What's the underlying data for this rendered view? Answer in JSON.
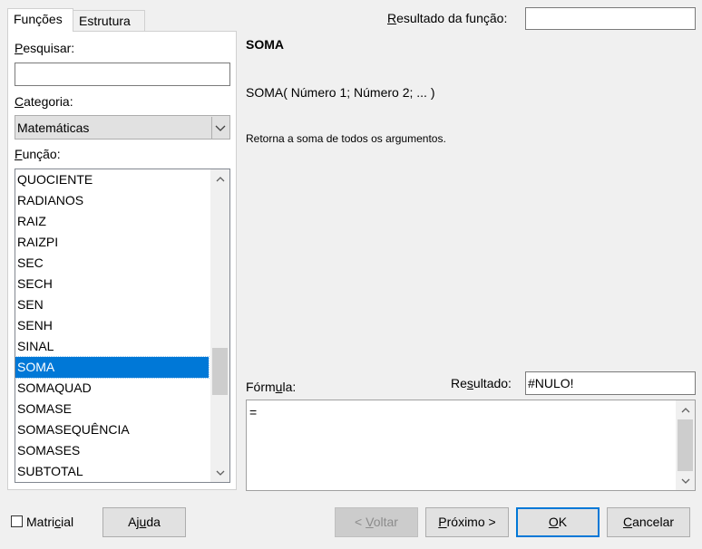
{
  "tabs": [
    {
      "label": "Funções",
      "active": true
    },
    {
      "label": "Estrutura",
      "active": false
    }
  ],
  "search": {
    "label_u": "P",
    "label_rest": "esquisar:",
    "value": ""
  },
  "category": {
    "label_u": "C",
    "label_rest": "ategoria:",
    "selected": "Matemáticas"
  },
  "function_list": {
    "label_u": "F",
    "label_rest": "unção:",
    "items": [
      "QUOCIENTE",
      "RADIANOS",
      "RAIZ",
      "RAIZPI",
      "SEC",
      "SECH",
      "SEN",
      "SENH",
      "SINAL",
      "SOMA",
      "SOMAQUAD",
      "SOMASE",
      "SOMASEQUÊNCIA",
      "SOMASES",
      "SUBTOTAL"
    ],
    "selected_index": 9,
    "scroll_position": 0.7
  },
  "function_result": {
    "label_u": "R",
    "label_rest": "esultado da função:",
    "value": ""
  },
  "info": {
    "name": "SOMA",
    "syntax": "SOMA( Número 1; Número 2; ...  )",
    "description": "Retorna a soma de todos os argumentos."
  },
  "formula": {
    "label_pre": "Fórm",
    "label_u": "u",
    "label_post": "la:",
    "value": "="
  },
  "result": {
    "label_pre": "Re",
    "label_u": "s",
    "label_post": "ultado:",
    "value": "#NULO!"
  },
  "matrix": {
    "label_pre": "Matri",
    "label_u": "c",
    "label_post": "ial",
    "checked": false
  },
  "buttons": {
    "help": {
      "pre": "Aj",
      "u": "u",
      "post": "da"
    },
    "back": {
      "pre": "< ",
      "u": "V",
      "post": "oltar"
    },
    "next": {
      "pre": "",
      "u": "P",
      "post": "róximo >"
    },
    "ok": {
      "pre": "",
      "u": "O",
      "post": "K"
    },
    "cancel": {
      "pre": "",
      "u": "C",
      "post": "ancelar"
    }
  }
}
